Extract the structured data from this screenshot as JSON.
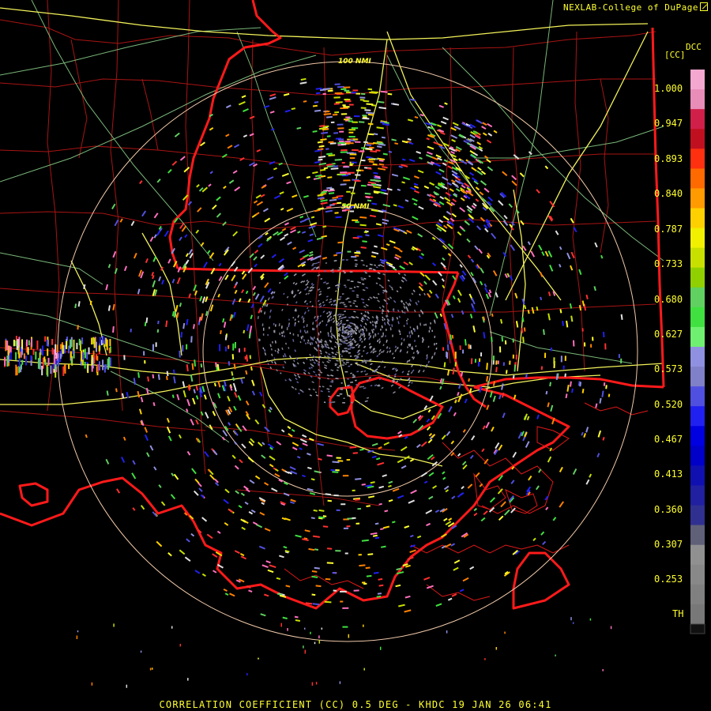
{
  "credit": "NEXLAB-College of DuPage",
  "credit_icon": "external-link-icon",
  "legend": {
    "product": "DCC",
    "unit": "[CC]",
    "labels": [
      "1.000",
      "0.947",
      "0.893",
      "0.840",
      "0.787",
      "0.733",
      "0.680",
      "0.627",
      "0.573",
      "0.520",
      "0.467",
      "0.413",
      "0.360",
      "0.307",
      "0.253",
      "TH"
    ]
  },
  "range_rings": {
    "outer": "100 NMI",
    "inner": "50 NMI"
  },
  "footer": "CORRELATION COEFFICIENT (CC) 0.5 DEG - KHDC 19 JAN 26 06:41",
  "colors": {
    "background": "#000000",
    "text": "#ffff30",
    "state_border": "#ff2020",
    "county_border": "#b01010",
    "highway": "#f0f060",
    "range_ring": "#f0c8a8",
    "road_minor": "#a0e0a0"
  }
}
